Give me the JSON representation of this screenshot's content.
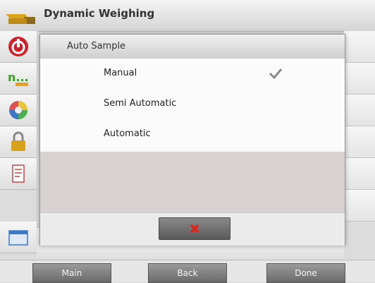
{
  "header": {
    "title": "Dynamic Weighing",
    "icon": "scale-tray-icon"
  },
  "sidebar": {
    "items": [
      {
        "icon": "power-icon",
        "color": "#d0212a"
      },
      {
        "icon": "units-icon",
        "text": "n...",
        "color": "#3c9a2a"
      },
      {
        "icon": "color-wheel-icon"
      },
      {
        "icon": "padlock-icon",
        "color": "#d8a21c"
      },
      {
        "icon": "printer-report-icon"
      },
      {
        "icon": "screen-window-icon",
        "color": "#3b78c7"
      }
    ]
  },
  "dialog": {
    "title": "Auto Sample",
    "options": [
      {
        "label": "Manual",
        "selected": true
      },
      {
        "label": "Semi Automatic",
        "selected": false
      },
      {
        "label": "Automatic",
        "selected": false
      }
    ],
    "cancel_icon": "close-x-icon",
    "cancel_color": "#e2231a"
  },
  "footer": {
    "main_label": "Main",
    "back_label": "Back",
    "done_label": "Done"
  }
}
